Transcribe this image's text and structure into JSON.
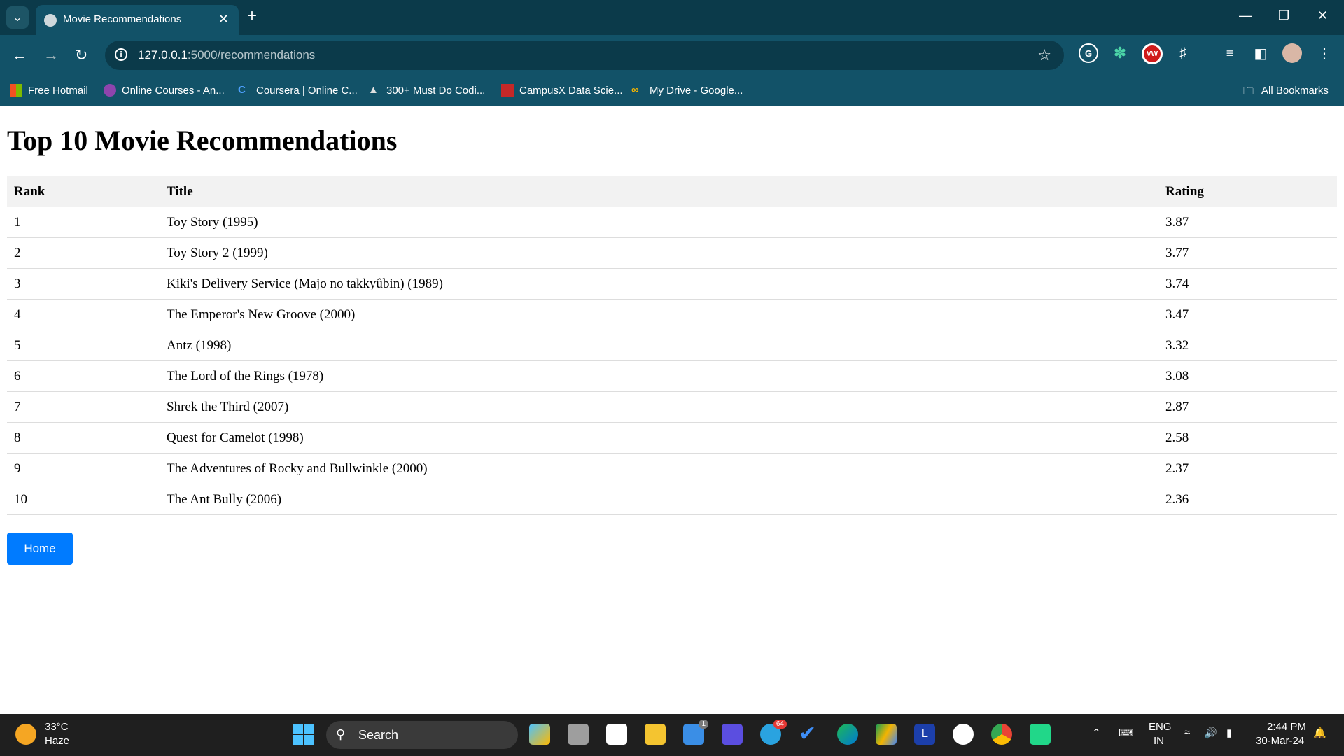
{
  "browser": {
    "tab_title": "Movie Recommendations",
    "url_host": "127.0.0.1",
    "url_rest": ":5000/recommendations",
    "bookmarks": [
      "Free Hotmail",
      "Online Courses - An...",
      "Coursera | Online C...",
      "300+ Must Do Codi...",
      "CampusX Data Scie...",
      "My Drive - Google..."
    ],
    "all_bookmarks": "All Bookmarks",
    "ext_vw": "VW"
  },
  "page": {
    "title": "Top 10 Movie Recommendations",
    "columns": [
      "Rank",
      "Title",
      "Rating"
    ],
    "rows": [
      {
        "rank": "1",
        "title": "Toy Story (1995)",
        "rating": "3.87"
      },
      {
        "rank": "2",
        "title": "Toy Story 2 (1999)",
        "rating": "3.77"
      },
      {
        "rank": "3",
        "title": "Kiki's Delivery Service (Majo no takkyûbin) (1989)",
        "rating": "3.74"
      },
      {
        "rank": "4",
        "title": "The Emperor's New Groove (2000)",
        "rating": "3.47"
      },
      {
        "rank": "5",
        "title": "Antz (1998)",
        "rating": "3.32"
      },
      {
        "rank": "6",
        "title": "The Lord of the Rings (1978)",
        "rating": "3.08"
      },
      {
        "rank": "7",
        "title": "Shrek the Third (2007)",
        "rating": "2.87"
      },
      {
        "rank": "8",
        "title": "Quest for Camelot (1998)",
        "rating": "2.58"
      },
      {
        "rank": "9",
        "title": "The Adventures of Rocky and Bullwinkle (2000)",
        "rating": "2.37"
      },
      {
        "rank": "10",
        "title": "The Ant Bully (2006)",
        "rating": "2.36"
      }
    ],
    "home_button": "Home"
  },
  "taskbar": {
    "temperature": "33°C",
    "condition": "Haze",
    "search_label": "Search",
    "lang_top": "ENG",
    "lang_bottom": "IN",
    "time": "2:44 PM",
    "date": "30-Mar-24",
    "mail_badge": "1",
    "telegram_badge": "64"
  }
}
